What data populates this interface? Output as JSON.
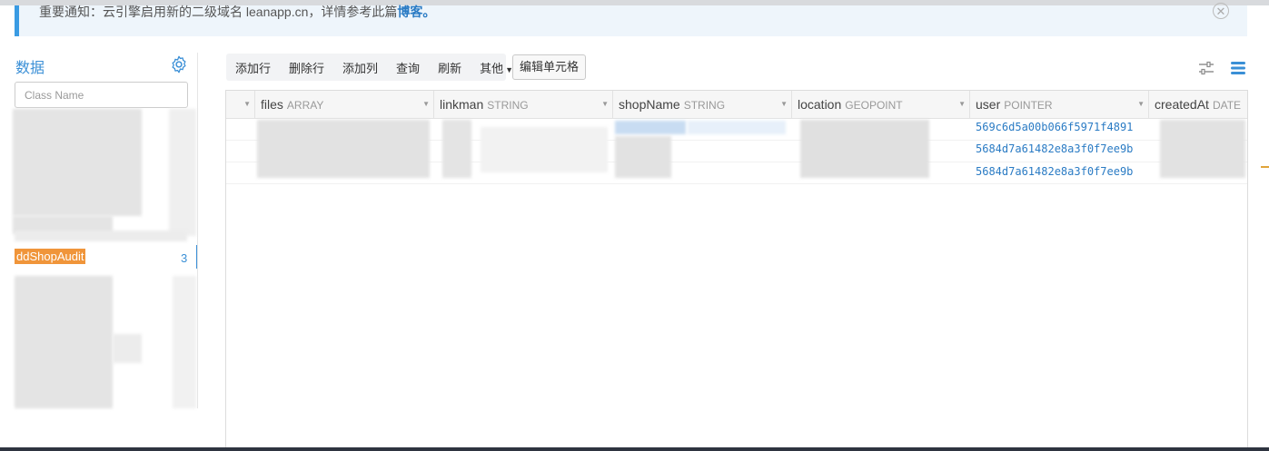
{
  "notice": {
    "text": "重要通知：云引擎启用新的二级域名 leanapp.cn，详情参考此篇",
    "link": "博客。",
    "close_glyph": "✕"
  },
  "sidebar": {
    "title": "数据",
    "search_placeholder": "Class Name",
    "active_item": {
      "label": "ddShopAudit",
      "count": "3"
    }
  },
  "toolbar": {
    "add_row": "添加行",
    "delete_row": "删除行",
    "add_column": "添加列",
    "query": "查询",
    "refresh": "刷新",
    "other": "其他",
    "edit_cell": "编辑单元格"
  },
  "grid": {
    "columns": [
      {
        "name": "files",
        "type": "ARRAY"
      },
      {
        "name": "linkman",
        "type": "STRING"
      },
      {
        "name": "shopName",
        "type": "STRING"
      },
      {
        "name": "location",
        "type": "GEOPOINT"
      },
      {
        "name": "user",
        "type": "POINTER"
      },
      {
        "name": "createdAt",
        "type": "DATE"
      }
    ],
    "user_values": [
      "569c6d5a00b066f5971f4891",
      "5684d7a61482e8a3f0f7ee9b",
      "5684d7a61482e8a3f0f7ee9b"
    ]
  },
  "colors": {
    "accent": "#3a8fd6",
    "highlight": "#f0953a",
    "link": "#2a7bc4"
  },
  "icons": [
    "close-icon",
    "gear-icon",
    "caret-down-icon",
    "sliders-icon",
    "list-icon"
  ]
}
